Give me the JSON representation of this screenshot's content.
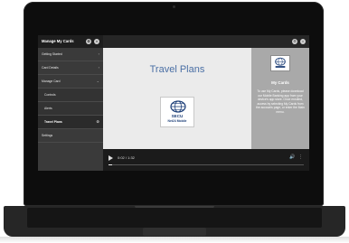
{
  "sidebar": {
    "title": "Manage My Cards",
    "items": [
      {
        "label": "Getting Started",
        "chev": "›"
      },
      {
        "label": "Card Details",
        "chev": "›"
      },
      {
        "label": "Manage Card",
        "chev": "⌄"
      },
      {
        "label": "Controls",
        "chev": ""
      },
      {
        "label": "Alerts",
        "chev": ""
      },
      {
        "label": "Travel Plans",
        "chev": "⚙"
      },
      {
        "label": "Settings",
        "chev": ""
      }
    ]
  },
  "slide": {
    "title": "Travel Plans",
    "logo_line1": "SECU",
    "logo_line2": "Net24 Mobile"
  },
  "right_panel": {
    "heading": "My Cards",
    "body": "To use My Cards, please download our Mobile Banking app from your device's app store. Once enrolled, access by selecting My Cards from the accounts page, or enter the Main menu."
  },
  "player": {
    "time": "0:02 / 1:32",
    "progress": 0.02,
    "play_icon": "play-icon",
    "volume_icon": "volume-icon",
    "more_icon": "more-icon"
  },
  "colors": {
    "title_blue": "#4a6fa5",
    "logo_navy": "#1d3f78",
    "panel_gray": "#a9a9a9"
  }
}
